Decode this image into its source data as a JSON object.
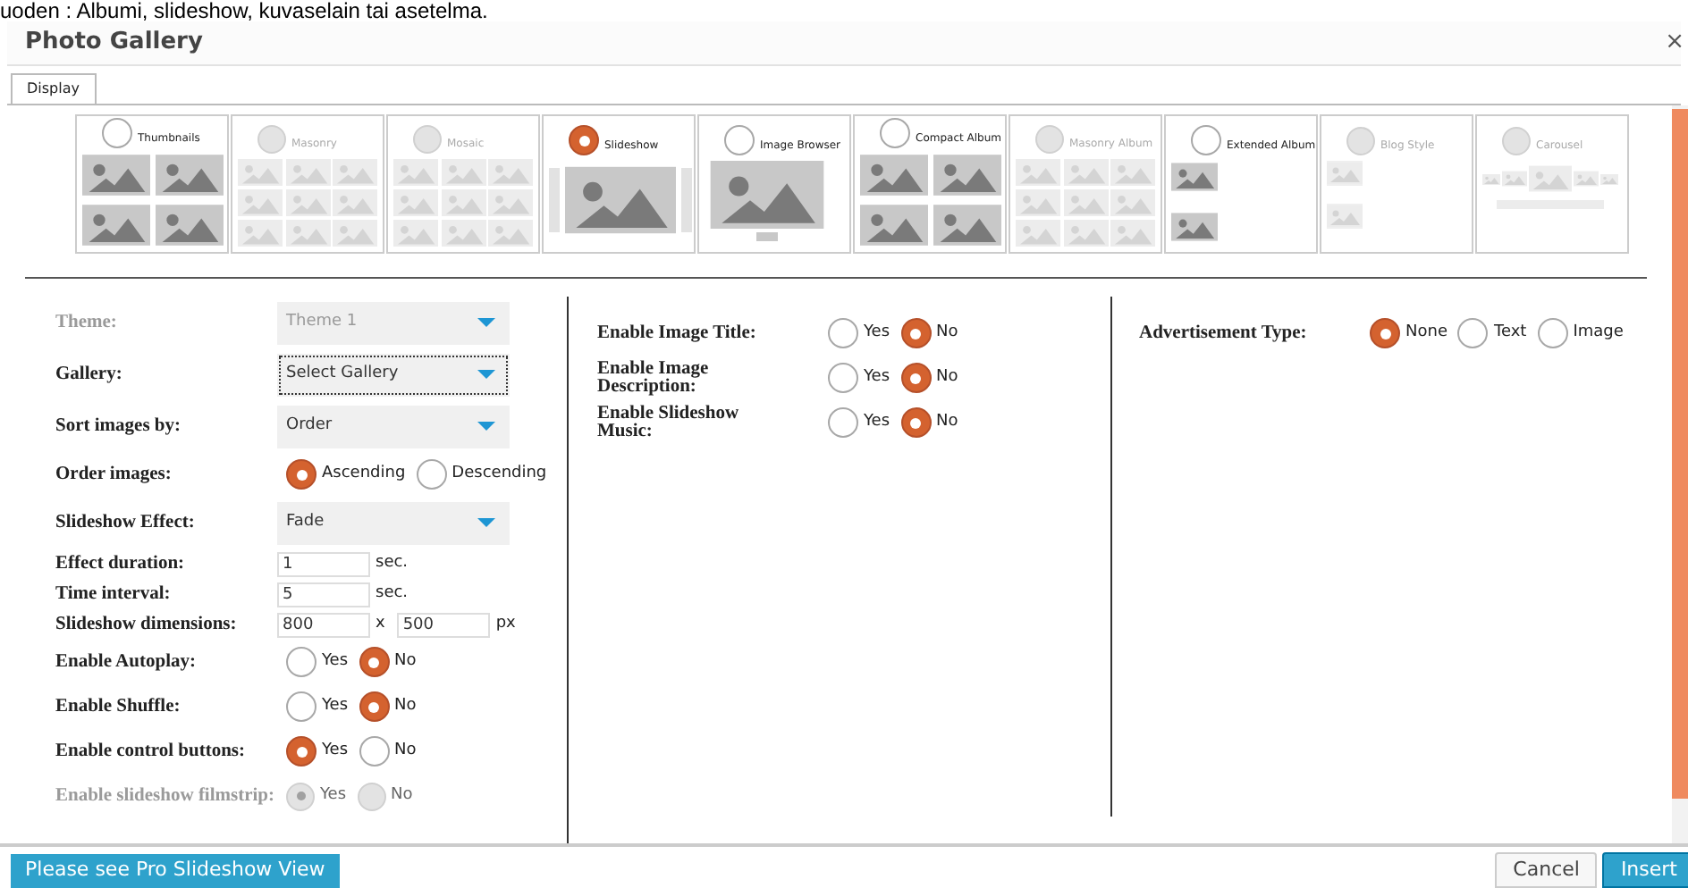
{
  "caption": "uoden : Albumi, slideshow, kuvaselain tai asetelma.",
  "window": {
    "title": "Photo Gallery",
    "close": "×"
  },
  "tabs": [
    {
      "label": "Display",
      "selected": true
    }
  ],
  "views": [
    {
      "label": "Thumbnails",
      "selected": false,
      "disabled": false,
      "kind": "grid"
    },
    {
      "label": "Masonry",
      "selected": false,
      "disabled": true,
      "kind": "masonry"
    },
    {
      "label": "Mosaic",
      "selected": false,
      "disabled": true,
      "kind": "masonry"
    },
    {
      "label": "Slideshow",
      "selected": true,
      "disabled": false,
      "kind": "slideshow"
    },
    {
      "label": "Image Browser",
      "selected": false,
      "disabled": false,
      "kind": "browser"
    },
    {
      "label": "Compact Album",
      "selected": false,
      "disabled": false,
      "kind": "grid"
    },
    {
      "label": "Masonry Album",
      "selected": false,
      "disabled": true,
      "kind": "masonry"
    },
    {
      "label": "Extended Album",
      "selected": false,
      "disabled": false,
      "kind": "list"
    },
    {
      "label": "Blog Style",
      "selected": false,
      "disabled": true,
      "kind": "blog"
    },
    {
      "label": "Carousel",
      "selected": false,
      "disabled": true,
      "kind": "carousel"
    }
  ],
  "columns": [
    [
      {
        "kind": "select",
        "label": "Theme:",
        "value": "Theme 1",
        "disabled": true,
        "focused": false
      },
      {
        "kind": "select",
        "label": "Gallery:",
        "value": "Select Gallery",
        "disabled": false,
        "focused": true
      },
      {
        "kind": "select",
        "label": "Sort images by:",
        "value": "Order",
        "disabled": false,
        "focused": false
      },
      {
        "kind": "radio",
        "label": "Order images:",
        "disabled": false,
        "options": [
          {
            "label": "Ascending",
            "selected": true
          },
          {
            "label": "Descending",
            "selected": false
          }
        ]
      },
      {
        "kind": "select",
        "label": "Slideshow Effect:",
        "value": "Fade",
        "disabled": false,
        "focused": false
      },
      {
        "kind": "inputs",
        "label": "Effect duration:",
        "parts": [
          {
            "kind": "input",
            "value": "1"
          },
          {
            "kind": "text",
            "text": "sec."
          }
        ]
      },
      {
        "kind": "inputs",
        "label": "Time interval:",
        "parts": [
          {
            "kind": "input",
            "value": "5"
          },
          {
            "kind": "text",
            "text": "sec."
          }
        ]
      },
      {
        "kind": "inputs",
        "label": "Slideshow dimensions:",
        "parts": [
          {
            "kind": "input",
            "value": "800"
          },
          {
            "kind": "text",
            "text": "x"
          },
          {
            "kind": "input",
            "value": "500"
          },
          {
            "kind": "text",
            "text": "px"
          }
        ]
      },
      {
        "kind": "radio",
        "label": "Enable Autoplay:",
        "disabled": false,
        "options": [
          {
            "label": "Yes",
            "selected": false
          },
          {
            "label": "No",
            "selected": true
          }
        ]
      },
      {
        "kind": "radio",
        "label": "Enable Shuffle:",
        "disabled": false,
        "options": [
          {
            "label": "Yes",
            "selected": false
          },
          {
            "label": "No",
            "selected": true
          }
        ]
      },
      {
        "kind": "radio",
        "label": "Enable control buttons:",
        "disabled": false,
        "options": [
          {
            "label": "Yes",
            "selected": true
          },
          {
            "label": "No",
            "selected": false
          }
        ]
      },
      {
        "kind": "radio",
        "label": "Enable slideshow filmstrip:",
        "disabled": true,
        "options": [
          {
            "label": "Yes",
            "selected": true
          },
          {
            "label": "No",
            "selected": false
          }
        ]
      }
    ],
    [
      {
        "kind": "radio",
        "label": "Enable Image Title:",
        "disabled": false,
        "options": [
          {
            "label": "Yes",
            "selected": false
          },
          {
            "label": "No",
            "selected": true
          }
        ]
      },
      {
        "kind": "radio",
        "label": "Enable Image Description:",
        "disabled": false,
        "options": [
          {
            "label": "Yes",
            "selected": false
          },
          {
            "label": "No",
            "selected": true
          }
        ]
      },
      {
        "kind": "radio",
        "label": "Enable Slideshow Music:",
        "disabled": false,
        "options": [
          {
            "label": "Yes",
            "selected": false
          },
          {
            "label": "No",
            "selected": true
          }
        ]
      }
    ],
    [
      {
        "kind": "radio",
        "label": "Advertisement Type:",
        "disabled": false,
        "options": [
          {
            "label": "None",
            "selected": true
          },
          {
            "label": "Text",
            "selected": false
          },
          {
            "label": "Image",
            "selected": false
          }
        ]
      }
    ]
  ],
  "footer": {
    "pro_link": "Please see Pro Slideshow View",
    "buttons": [
      {
        "label": "Cancel",
        "kind": "secondary"
      },
      {
        "label": "Insert",
        "kind": "primary"
      }
    ]
  }
}
